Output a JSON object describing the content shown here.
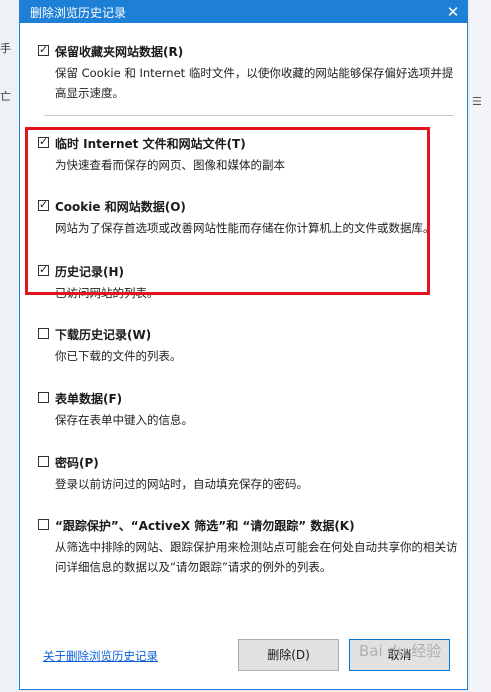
{
  "background": {
    "left_fragments": [
      "手",
      "亡"
    ],
    "right_fragments": [
      "☰"
    ]
  },
  "dialog": {
    "title": "删除浏览历史记录",
    "close_glyph": "✕"
  },
  "options": [
    {
      "label": "保留收藏夹网站数据(R)",
      "checked": true,
      "description": "保留 Cookie 和 Internet 临时文件，以使你收藏的网站能够保存偏好选项并提高显示速度。"
    },
    {
      "label": "临时 Internet 文件和网站文件(T)",
      "checked": true,
      "description": "为快速查看而保存的网页、图像和媒体的副本"
    },
    {
      "label": "Cookie 和网站数据(O)",
      "checked": true,
      "description": "网站为了保存首选项或改善网站性能而存储在你计算机上的文件或数据库。"
    },
    {
      "label": "历史记录(H)",
      "checked": true,
      "description": "已访问网站的列表。"
    },
    {
      "label": "下载历史记录(W)",
      "checked": false,
      "description": "你已下载的文件的列表。"
    },
    {
      "label": "表单数据(F)",
      "checked": false,
      "description": "保存在表单中键入的信息。"
    },
    {
      "label": "密码(P)",
      "checked": false,
      "description": "登录以前访问过的网站时，自动填充保存的密码。"
    },
    {
      "label": "“跟踪保护”、“ActiveX 筛选”和 “请勿跟踪” 数据(K)",
      "checked": false,
      "description": "从筛选中排除的网站、跟踪保护用来检测站点可能会在何处自动共享你的相关访问详细信息的数据以及“请勿跟踪”请求的例外的列表。"
    }
  ],
  "check_glyph": "✓",
  "footer": {
    "link": "关于删除浏览历史记录",
    "delete_button": "删除(D)",
    "cancel_button": "取消"
  },
  "watermark": "Bai du 经验",
  "colors": {
    "accent": "#1e7fd6",
    "highlight": "#e3141b",
    "link": "#0a5fd6"
  }
}
